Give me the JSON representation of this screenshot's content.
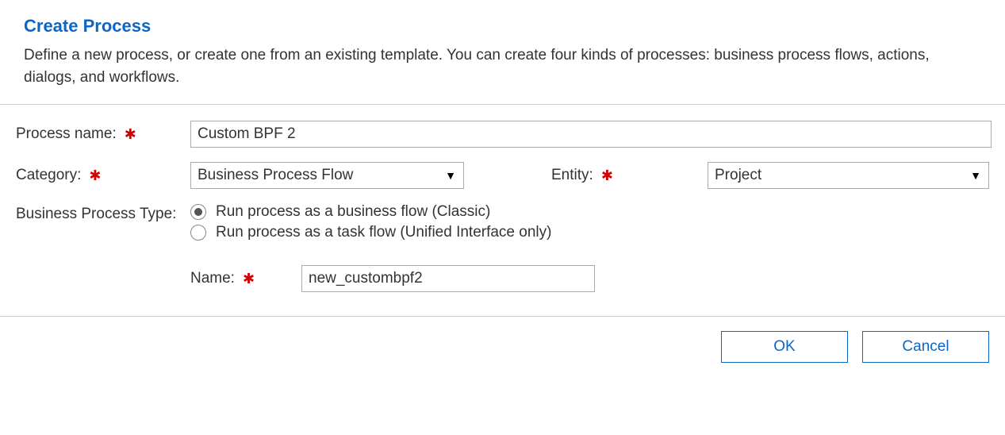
{
  "header": {
    "title": "Create Process",
    "description": "Define a new process, or create one from an existing template. You can create four kinds of processes: business process flows, actions, dialogs, and workflows."
  },
  "form": {
    "process_name_label": "Process name:",
    "process_name_value": "Custom BPF 2",
    "category_label": "Category:",
    "category_value": "Business Process Flow",
    "entity_label": "Entity:",
    "entity_value": "Project",
    "bpt_label": "Business Process Type:",
    "bpt_option_classic": "Run process as a business flow (Classic)",
    "bpt_option_taskflow": "Run process as a task flow (Unified Interface only)",
    "bpt_selected": "classic",
    "name_label": "Name:",
    "name_value": "new_custombpf2"
  },
  "footer": {
    "ok_label": "OK",
    "cancel_label": "Cancel"
  }
}
